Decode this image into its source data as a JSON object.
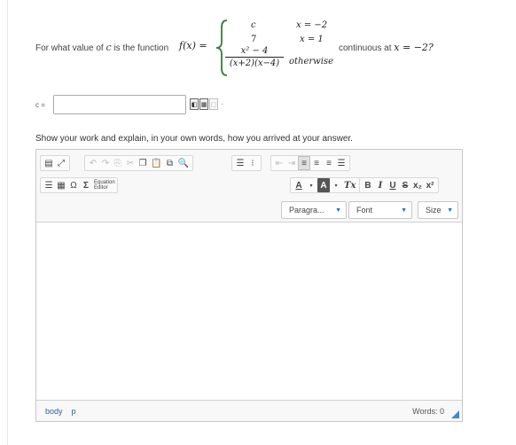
{
  "question": {
    "prefix": "For what value of",
    "var_c": "c",
    "middle": "is the function",
    "fx": "f(x) =",
    "pieces": [
      {
        "value": "c",
        "condition": "x = −2"
      },
      {
        "value": "7",
        "condition": "x = 1"
      },
      {
        "numerator": "x² − 4",
        "denominator": "(x+2)(x−4)",
        "condition": "otherwise"
      }
    ],
    "suffix_pre": "continuous at",
    "suffix_point": "x = −2?"
  },
  "answer": {
    "label": "c =",
    "value": "",
    "tool_icons": [
      "symbol-icon",
      "preview-icon",
      "help-icon"
    ]
  },
  "instructions": "Show your work and explain, in your own words, how you arrived at your answer.",
  "editor": {
    "toolbar": {
      "row1": [
        "source",
        "maximize",
        "undo",
        "redo",
        "paste-text",
        "cut",
        "copy",
        "paste",
        "paste-word",
        "find",
        "numbered-list",
        "bulleted-list",
        "outdent",
        "indent",
        "align-left",
        "align-center",
        "align-right",
        "justify"
      ],
      "row2": [
        "horizontal-rule",
        "table",
        "Ω",
        "Σ"
      ],
      "equation_editor_l1": "Equation",
      "equation_editor_l2": "Editor",
      "format": {
        "text_color": "A",
        "bg_color": "A",
        "remove_format": "Tx",
        "bold": "B",
        "italic": "I",
        "underline": "U",
        "strike": "S",
        "subscript": "x₂",
        "superscript": "x²"
      },
      "paragraph": "Paragra...",
      "font": "Font",
      "size": "Size"
    },
    "path": [
      "body",
      "p"
    ],
    "words_label": "Words: 0"
  },
  "colors": {
    "accent": "#4a86c5",
    "link": "#2f5f9f",
    "brace": "#3a7a3a"
  }
}
